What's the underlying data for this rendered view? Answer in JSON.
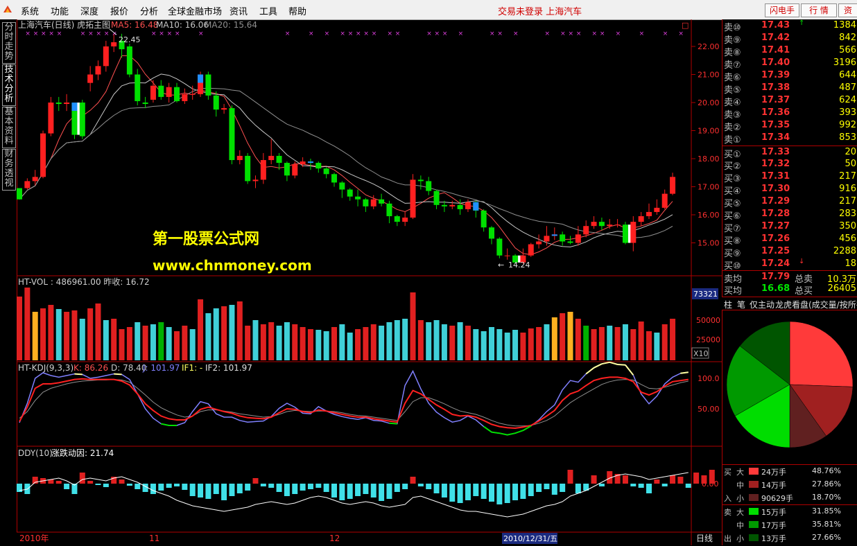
{
  "menu": {
    "items": [
      "系统",
      "功能",
      "深度",
      "报价",
      "分析",
      "全球金融市场",
      "资讯",
      "工具",
      "帮助"
    ],
    "status": "交易未登录 上海汽车",
    "buttons": [
      "闪电手",
      "行  情",
      "资"
    ]
  },
  "left_tabs": [
    "分时走势",
    "技术分析",
    "基本资料",
    "财务透视"
  ],
  "main_chart": {
    "title": "上海汽车(日线) 虎拓主图",
    "ma_labels": [
      {
        "text": "MA5: 16.48",
        "color": "#ff5050"
      },
      {
        "text": "MA10: 16.06",
        "color": "#c8c8c8"
      },
      {
        "text": "MA20: 15.64",
        "color": "#909090"
      }
    ],
    "price_ticks": [
      "22.00",
      "21.00",
      "20.00",
      "19.00",
      "18.00",
      "17.00",
      "16.00",
      "15.00"
    ],
    "high_label": "22.45",
    "low_label": "14.24",
    "watermark_line1": "第一股票公式网",
    "watermark_line2": "www.chnmoney.com",
    "corner_button": "□"
  },
  "candles": [
    [
      16.95,
      16.55,
      16.95,
      16.55
    ],
    [
      16.95,
      17.2,
      17.3,
      16.9
    ],
    [
      17.2,
      17.35,
      17.6,
      17.05
    ],
    [
      17.35,
      18.9,
      19.0,
      17.3
    ],
    [
      18.9,
      20.0,
      20.2,
      18.8
    ],
    [
      20.0,
      19.95,
      20.2,
      19.7
    ],
    [
      19.95,
      20.0,
      20.3,
      19.7
    ],
    [
      20.0,
      18.85,
      20.0,
      18.7
    ],
    [
      20.0,
      18.8,
      20.1,
      18.7
    ],
    [
      20.7,
      21.0,
      21.3,
      20.4
    ],
    [
      21.0,
      21.3,
      21.5,
      20.8
    ],
    [
      21.3,
      22.0,
      22.2,
      21.1
    ],
    [
      22.0,
      22.15,
      22.45,
      21.8
    ],
    [
      22.2,
      21.9,
      22.45,
      21.6
    ],
    [
      22.0,
      21.0,
      22.1,
      20.9
    ],
    [
      21.0,
      20.05,
      21.2,
      19.9
    ],
    [
      20.0,
      19.95,
      20.2,
      19.8
    ],
    [
      20.1,
      20.6,
      20.8,
      20.0
    ],
    [
      20.6,
      20.2,
      20.8,
      20.1
    ],
    [
      20.2,
      20.55,
      20.7,
      20.0
    ],
    [
      20.55,
      20.05,
      20.7,
      20.0
    ],
    [
      20.05,
      20.3,
      20.5,
      19.95
    ],
    [
      20.3,
      20.3,
      20.6,
      20.1
    ],
    [
      20.3,
      21.0,
      21.1,
      20.2
    ],
    [
      21.0,
      20.25,
      21.1,
      20.1
    ],
    [
      20.25,
      19.75,
      20.4,
      19.5
    ],
    [
      19.75,
      19.8,
      19.95,
      19.6
    ],
    [
      19.8,
      17.95,
      19.9,
      17.8
    ],
    [
      17.95,
      18.1,
      18.3,
      17.8
    ],
    [
      18.1,
      17.2,
      18.2,
      17.1
    ],
    [
      17.2,
      17.25,
      17.4,
      16.95
    ],
    [
      17.25,
      17.95,
      18.2,
      17.1
    ],
    [
      17.95,
      18.1,
      18.7,
      17.8
    ],
    [
      18.1,
      17.85,
      18.2,
      17.6
    ],
    [
      17.85,
      17.4,
      17.9,
      17.2
    ],
    [
      17.4,
      17.8,
      17.9,
      17.3
    ],
    [
      17.8,
      17.9,
      18.05,
      17.7
    ],
    [
      17.9,
      17.85,
      18.0,
      17.6
    ],
    [
      17.85,
      17.65,
      17.9,
      17.5
    ],
    [
      17.65,
      17.45,
      17.7,
      17.3
    ],
    [
      17.45,
      17.15,
      17.5,
      17.0
    ],
    [
      17.15,
      16.9,
      17.2,
      16.6
    ],
    [
      16.9,
      16.65,
      16.95,
      16.5
    ],
    [
      16.65,
      16.55,
      16.9,
      16.3
    ],
    [
      16.55,
      16.3,
      16.6,
      16.1
    ],
    [
      16.3,
      16.55,
      16.7,
      16.2
    ],
    [
      16.55,
      16.4,
      16.75,
      16.3
    ],
    [
      16.4,
      15.95,
      16.5,
      15.7
    ],
    [
      15.95,
      15.75,
      16.0,
      15.6
    ],
    [
      15.75,
      15.9,
      16.1,
      15.6
    ],
    [
      15.9,
      17.25,
      17.45,
      15.85
    ],
    [
      17.25,
      17.2,
      17.4,
      16.9
    ],
    [
      17.2,
      16.85,
      17.35,
      16.7
    ],
    [
      16.85,
      16.35,
      16.9,
      16.2
    ],
    [
      16.35,
      16.3,
      16.5,
      16.1
    ],
    [
      16.3,
      16.35,
      16.5,
      16.2
    ],
    [
      16.35,
      16.2,
      16.55,
      16.0
    ],
    [
      16.2,
      16.45,
      16.55,
      16.1
    ],
    [
      16.45,
      16.15,
      16.5,
      15.9
    ],
    [
      16.15,
      15.55,
      16.2,
      15.4
    ],
    [
      15.55,
      15.15,
      15.6,
      14.95
    ],
    [
      15.15,
      14.55,
      15.2,
      14.45
    ],
    [
      14.55,
      14.55,
      14.8,
      14.4
    ],
    [
      14.55,
      14.3,
      14.6,
      14.24
    ],
    [
      14.3,
      14.55,
      14.8,
      14.25
    ],
    [
      14.55,
      14.95,
      15.0,
      14.5
    ],
    [
      14.95,
      15.05,
      15.3,
      14.8
    ],
    [
      15.05,
      15.25,
      15.6,
      14.9
    ],
    [
      15.25,
      15.3,
      15.55,
      15.1
    ],
    [
      15.3,
      15.05,
      15.4,
      14.9
    ],
    [
      15.05,
      15.0,
      15.25,
      14.95
    ],
    [
      15.0,
      15.3,
      15.6,
      14.9
    ],
    [
      15.3,
      15.6,
      15.8,
      15.2
    ],
    [
      15.6,
      15.75,
      15.95,
      15.5
    ],
    [
      15.75,
      15.6,
      15.9,
      15.45
    ],
    [
      15.6,
      15.65,
      15.85,
      15.5
    ],
    [
      15.65,
      15.65,
      15.85,
      15.55
    ],
    [
      15.65,
      15.0,
      15.75,
      14.95
    ],
    [
      15.0,
      15.75,
      15.95,
      14.7
    ],
    [
      15.75,
      15.95,
      16.1,
      15.6
    ],
    [
      15.95,
      16.1,
      16.4,
      15.85
    ],
    [
      16.1,
      16.25,
      16.55,
      16.0
    ],
    [
      16.25,
      16.75,
      16.9,
      16.2
    ],
    [
      16.75,
      17.35,
      17.5,
      16.7
    ]
  ],
  "volume": {
    "title": "HT-VOL : 486961.00 昨收: 16.72",
    "cursor_value": "73321",
    "ticks": [
      "50000",
      "25000"
    ],
    "multiplier": "X10",
    "values": [
      92,
      105,
      70,
      75,
      80,
      74,
      70,
      72,
      60,
      75,
      82,
      58,
      60,
      45,
      48,
      55,
      50,
      52,
      55,
      48,
      42,
      50,
      45,
      88,
      68,
      75,
      78,
      80,
      85,
      50,
      58,
      52,
      55,
      50,
      55,
      52,
      48,
      45,
      44,
      42,
      48,
      52,
      40,
      45,
      48,
      52,
      50,
      55,
      58,
      60,
      98,
      58,
      55,
      58,
      52,
      50,
      55,
      50,
      45,
      42,
      48,
      45,
      40,
      44,
      40,
      46,
      48,
      52,
      62,
      68,
      70,
      60,
      50,
      45,
      48,
      50,
      48,
      52,
      45,
      56,
      42,
      40,
      52,
      60
    ],
    "colors": [
      "r",
      "r",
      "c",
      "r",
      "r",
      "c",
      "r",
      "r",
      "c",
      "r",
      "r",
      "c",
      "r",
      "r",
      "r",
      "c",
      "r",
      "c",
      "g",
      "c",
      "r",
      "r",
      "c",
      "r",
      "c",
      "c",
      "r",
      "c",
      "r",
      "r",
      "c",
      "r",
      "r",
      "c",
      "c",
      "r",
      "r",
      "r",
      "c",
      "c",
      "r",
      "c",
      "c",
      "r",
      "r",
      "r",
      "c",
      "c",
      "c",
      "c",
      "r",
      "r",
      "c",
      "c",
      "c",
      "r",
      "c",
      "r",
      "c",
      "c",
      "c",
      "c",
      "c",
      "c",
      "r",
      "r",
      "r",
      "c",
      "r",
      "r",
      "y",
      "r",
      "g",
      "r",
      "r",
      "c",
      "r",
      "c",
      "r",
      "r",
      "r",
      "c",
      "r",
      "r"
    ],
    "yellow_bars": [
      2,
      68,
      70
    ]
  },
  "kdj": {
    "title": "HT-KDJ(9,3,3)",
    "k_label": "K: 86.26",
    "d_label": "D: 78.40",
    "j_label": "J: 101.97",
    "if1_label": "IF1: -",
    "if2_label": "IF2: 101.97",
    "ticks": [
      "100.0",
      "50.00"
    ],
    "j": [
      10,
      45,
      90,
      100,
      95,
      92,
      95,
      98,
      97,
      90,
      92,
      95,
      98,
      97,
      88,
      62,
      35,
      18,
      8,
      5,
      5,
      10,
      30,
      48,
      44,
      26,
      20,
      20,
      14,
      11,
      12,
      13,
      21,
      36,
      45,
      38,
      27,
      26,
      39,
      31,
      25,
      21,
      18,
      16,
      19,
      14,
      13,
      9,
      8,
      77,
      103,
      71,
      45,
      29,
      19,
      11,
      14,
      22,
      15,
      3,
      -7,
      -9,
      -12,
      -9,
      -4,
      4,
      15,
      30,
      42,
      69,
      86,
      83,
      98,
      109,
      116,
      119,
      115,
      114,
      96,
      62,
      44,
      58,
      80,
      92,
      99,
      101
    ],
    "k": [
      12,
      38,
      72,
      80,
      80,
      82,
      85,
      88,
      89,
      88,
      88,
      88,
      88,
      85,
      78,
      62,
      44,
      32,
      22,
      17,
      15,
      15,
      22,
      34,
      38,
      34,
      30,
      27,
      22,
      19,
      18,
      17,
      20,
      28,
      35,
      34,
      30,
      28,
      33,
      31,
      28,
      25,
      22,
      20,
      20,
      17,
      15,
      13,
      11,
      45,
      68,
      62,
      52,
      42,
      34,
      25,
      22,
      23,
      20,
      14,
      7,
      3,
      1,
      0,
      2,
      5,
      13,
      22,
      32,
      50,
      62,
      67,
      77,
      86,
      90,
      92,
      92,
      90,
      84,
      65,
      60,
      66,
      76,
      84,
      86,
      88
    ],
    "d": [
      18,
      30,
      50,
      65,
      72,
      76,
      80,
      83,
      85,
      86,
      87,
      87,
      88,
      87,
      83,
      72,
      60,
      47,
      37,
      30,
      24,
      20,
      22,
      30,
      33,
      33,
      31,
      29,
      26,
      24,
      22,
      20,
      21,
      25,
      30,
      32,
      31,
      30,
      31,
      31,
      30,
      28,
      25,
      23,
      22,
      20,
      18,
      16,
      14,
      30,
      48,
      55,
      55,
      50,
      44,
      37,
      31,
      28,
      25,
      20,
      14,
      9,
      6,
      4,
      4,
      5,
      9,
      14,
      22,
      34,
      46,
      55,
      63,
      71,
      79,
      84,
      87,
      88,
      87,
      79,
      72,
      71,
      74,
      78,
      82,
      85
    ]
  },
  "ddy": {
    "title": "DDY(10)",
    "subtitle": "涨跌动因: 21.74",
    "tick": "0.00",
    "bars": [
      -12,
      -15,
      10,
      8,
      6,
      4,
      -8,
      -15,
      16,
      4,
      -2,
      -5,
      10,
      6,
      -3,
      -8,
      -12,
      -15,
      -10,
      -6,
      -4,
      -9,
      -18,
      -20,
      -22,
      -15,
      -24,
      -18,
      -14,
      -10,
      8,
      -4,
      -6,
      -12,
      -18,
      -15,
      -10,
      -8,
      -6,
      -12,
      -20,
      -24,
      -22,
      -18,
      -15,
      -20,
      -25,
      -22,
      -12,
      -8,
      10,
      -4,
      -8,
      -14,
      -20,
      -26,
      -28,
      -24,
      -18,
      -22,
      -26,
      -30,
      -28,
      -24,
      -22,
      -18,
      -12,
      -8,
      -16,
      -12,
      20,
      -14,
      -10,
      12,
      -4,
      18,
      14,
      12,
      -4,
      -6,
      -14,
      6,
      -4,
      12,
      10,
      -6,
      16,
      12,
      20
    ],
    "line": [
      -10,
      -8,
      2,
      4,
      6,
      8,
      4,
      -2,
      6,
      8,
      6,
      4,
      8,
      10,
      6,
      2,
      -4,
      -10,
      -14,
      -18,
      -24,
      -28,
      -32,
      -34,
      -36,
      -38,
      -40,
      -38,
      -36,
      -34,
      -30,
      -28,
      -26,
      -28,
      -30,
      -28,
      -24,
      -20,
      -18,
      -20,
      -24,
      -28,
      -30,
      -28,
      -26,
      -28,
      -32,
      -34,
      -32,
      -30,
      -20,
      -18,
      -22,
      -26,
      -30,
      -34,
      -38,
      -40,
      -40,
      -42,
      -44,
      -46,
      -48,
      -46,
      -44,
      -40,
      -36,
      -32,
      -30,
      -26,
      -18,
      -14,
      -10,
      -4,
      2,
      8,
      12,
      14,
      12,
      10,
      6,
      8,
      10,
      12,
      14,
      16
    ]
  },
  "dates": {
    "labels": [
      "2010年",
      "11",
      "12"
    ],
    "cursor": "2010/12/31/五",
    "period": "日线"
  },
  "orderbook": {
    "sell": [
      {
        "label": "卖⑩",
        "price": "17.43",
        "vol": "1384",
        "mark": "↑"
      },
      {
        "label": "卖⑨",
        "price": "17.42",
        "vol": "842",
        "mark": ""
      },
      {
        "label": "卖⑧",
        "price": "17.41",
        "vol": "566",
        "mark": ""
      },
      {
        "label": "卖⑦",
        "price": "17.40",
        "vol": "3196",
        "mark": ""
      },
      {
        "label": "卖⑥",
        "price": "17.39",
        "vol": "644",
        "mark": ""
      },
      {
        "label": "卖⑤",
        "price": "17.38",
        "vol": "487",
        "mark": ""
      },
      {
        "label": "卖④",
        "price": "17.37",
        "vol": "624",
        "mark": ""
      },
      {
        "label": "卖③",
        "price": "17.36",
        "vol": "393",
        "mark": ""
      },
      {
        "label": "卖②",
        "price": "17.35",
        "vol": "992",
        "mark": ""
      },
      {
        "label": "卖①",
        "price": "17.34",
        "vol": "853",
        "mark": ""
      }
    ],
    "buy": [
      {
        "label": "买①",
        "price": "17.33",
        "vol": "20",
        "mark": ""
      },
      {
        "label": "买②",
        "price": "17.32",
        "vol": "50",
        "mark": ""
      },
      {
        "label": "买③",
        "price": "17.31",
        "vol": "217",
        "mark": ""
      },
      {
        "label": "买④",
        "price": "17.30",
        "vol": "916",
        "mark": ""
      },
      {
        "label": "买⑤",
        "price": "17.29",
        "vol": "217",
        "mark": ""
      },
      {
        "label": "买⑥",
        "price": "17.28",
        "vol": "283",
        "mark": ""
      },
      {
        "label": "买⑦",
        "price": "17.27",
        "vol": "350",
        "mark": ""
      },
      {
        "label": "买⑧",
        "price": "17.26",
        "vol": "456",
        "mark": ""
      },
      {
        "label": "买⑨",
        "price": "17.25",
        "vol": "2288",
        "mark": ""
      },
      {
        "label": "买⑩",
        "price": "17.24",
        "vol": "18",
        "mark": "↓"
      }
    ],
    "avg_sell_label": "卖均",
    "avg_sell": "17.79",
    "total_sell_label": "总卖",
    "total_sell": "10.3万",
    "avg_buy_label": "买均",
    "avg_buy": "16.68",
    "total_buy_label": "总买",
    "total_buy": "26405"
  },
  "analysis_tabs": [
    "柱",
    "笔",
    "仅主动",
    "龙虎看盘(成交量/按所有)"
  ],
  "pie": [
    {
      "share": 48.76,
      "color": "#ff3a3a"
    },
    {
      "share": 27.86,
      "color": "#a02020"
    },
    {
      "share": 18.7,
      "color": "#602020"
    },
    {
      "share": 31.85,
      "color": "#00dd00"
    },
    {
      "share": 35.81,
      "color": "#009900"
    },
    {
      "share": 27.66,
      "color": "#005500"
    }
  ],
  "flows": {
    "buy_side": [
      "买",
      "入"
    ],
    "sell_side": [
      "卖",
      "出"
    ],
    "buy": [
      {
        "size": "大",
        "amount": "24万手",
        "pct": "48.76%",
        "color": "#ff3a3a"
      },
      {
        "size": "中",
        "amount": "14万手",
        "pct": "27.86%",
        "color": "#a02020"
      },
      {
        "size": "小",
        "amount": "90629手",
        "pct": "18.70%",
        "color": "#602020"
      }
    ],
    "sell": [
      {
        "size": "大",
        "amount": "15万手",
        "pct": "31.85%",
        "color": "#00dd00"
      },
      {
        "size": "中",
        "amount": "17万手",
        "pct": "35.81%",
        "color": "#009900"
      },
      {
        "size": "小",
        "amount": "13万手",
        "pct": "27.66%",
        "color": "#005500"
      }
    ]
  }
}
